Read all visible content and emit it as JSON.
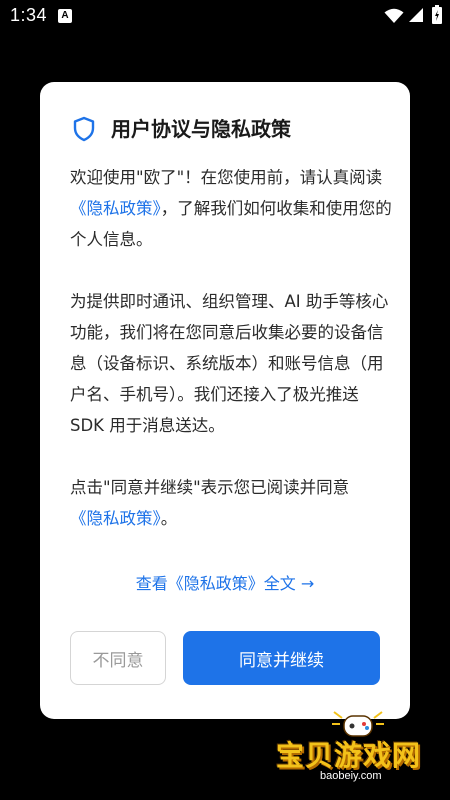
{
  "status_bar": {
    "time": "1:34",
    "app_icon_letter": "A",
    "icons": [
      "wifi-icon",
      "signal-icon",
      "battery-icon"
    ]
  },
  "dialog": {
    "title": "用户协议与隐私政策",
    "paragraphs": {
      "p1": {
        "a": "欢迎使用\"欧了\"！在您使用前，请认真阅读",
        "link": "《隐私政策》",
        "b": "，了解我们如何收集和使用您的个人信息。"
      },
      "p2": {
        "text": "为提供即时通讯、组织管理、AI 助手等核心功能，我们将在您同意后收集必要的设备信息（设备标识、系统版本）和账号信息（用户名、手机号）。我们还接入了极光推送 SDK 用于消息送达。"
      },
      "p3": {
        "a": "点击\"同意并继续\"表示您已阅读并同意",
        "link": "《隐私政策》",
        "b": "。"
      }
    },
    "view_full_link": "查看《隐私政策》全文 →",
    "disagree_label": "不同意",
    "agree_label": "同意并继续"
  },
  "watermark": {
    "text": "宝贝游戏网",
    "url": "baobeiy.com"
  },
  "colors": {
    "accent": "#1e73e8",
    "background": "#000000",
    "dialog_bg": "#ffffff"
  }
}
